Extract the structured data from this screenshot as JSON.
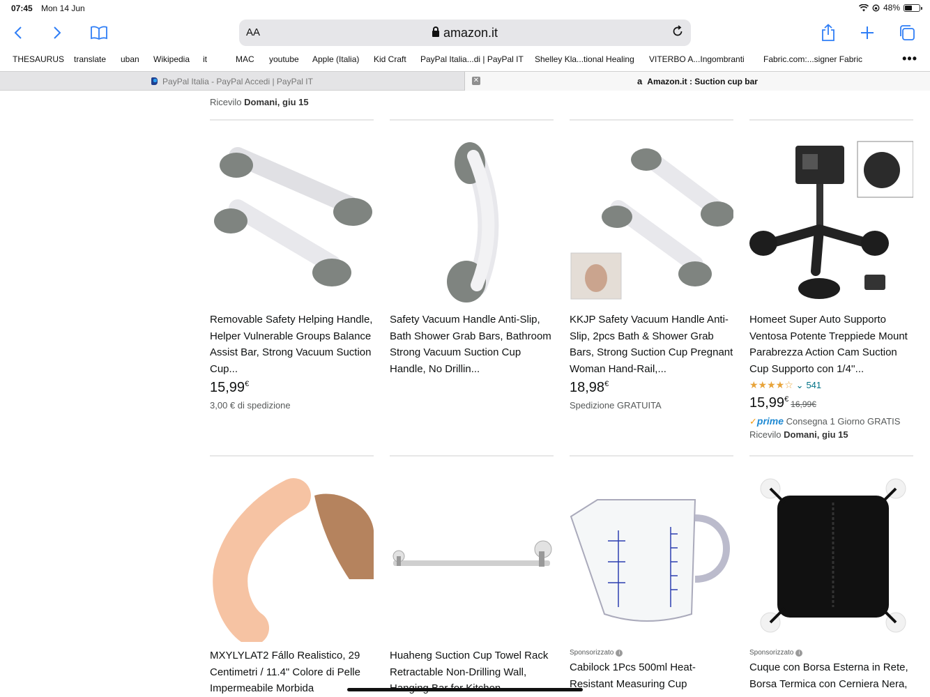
{
  "status_bar": {
    "time": "07:45",
    "date": "Mon 14 Jun",
    "battery": "48%",
    "battery_level": 0.48
  },
  "toolbar": {
    "aa_label": "AA",
    "domain": "amazon.it",
    "icons": [
      "back-icon",
      "forward-icon",
      "bookmarks-icon",
      "reload-icon",
      "share-icon",
      "new-tab-icon",
      "tabs-overview-icon"
    ]
  },
  "bookmarks": [
    "THESAURUS",
    "translate",
    "uban",
    "Wikipedia",
    "it",
    "MAC",
    "youtube",
    "Apple (Italia)",
    "Kid Craft",
    "PayPal Italia...di | PayPal IT",
    "Shelley Kla...tional Healing",
    "VITERBO A...Ingombranti",
    "Fabric.com:...signer Fabric"
  ],
  "bookmarks_more": "•••",
  "tabs": [
    {
      "title": "PayPal Italia - PayPal Accedi | PayPal IT",
      "active": false
    },
    {
      "title": "Amazon.it : Suction cup bar",
      "active": true
    }
  ],
  "previous_row": {
    "label": "Ricevilo ",
    "bold": "Domani, giu 15"
  },
  "products_row1": [
    {
      "title": "Removable Safety Helping Handle, Helper Vulnerable Groups Balance Assist Bar, Strong Vacuum Suction Cup...",
      "price": "15,99",
      "currency": "€",
      "shipping": "3,00 € di spedizione"
    },
    {
      "title": "Safety Vacuum Handle Anti-Slip, Bath Shower Grab Bars, Bathroom Strong Vacuum Suction Cup Handle, No Drillin...",
      "price": "",
      "currency": "",
      "shipping": ""
    },
    {
      "title": "KKJP Safety Vacuum Handle Anti-Slip, 2pcs Bath & Shower Grab Bars, Strong Suction Cup Pregnant Woman Hand-Rail,...",
      "price": "18,98",
      "currency": "€",
      "shipping": "Spedizione GRATUITA"
    },
    {
      "title": "Homeet Super Auto Supporto Ventosa Potente Treppiede Mount Parabrezza Action Cam Suction Cup Supporto con 1/4''...",
      "rating": 4.5,
      "stars": "★★★★☆",
      "rating_chevron": "⌄",
      "reviews": "541",
      "price": "15,99",
      "currency": "€",
      "old_price": "16,99€",
      "prime_check": "✓",
      "prime_label": "prime",
      "prime_text": " Consegna 1 Giorno GRATIS",
      "deliver_label": "Ricevilo ",
      "deliver_bold": "Domani, giu 15"
    }
  ],
  "products_row2": [
    {
      "title": "MXYLYLAT2 Fállo Realistico, 29 Centimetri / 11.4\" Colore di Pelle Impermeabile Morbida",
      "sponsored": ""
    },
    {
      "title": "Huaheng Suction Cup Towel Rack Retractable Non-Drilling Wall, Hanging Bar for Kitchen",
      "sponsored": ""
    },
    {
      "title": "Cabilock 1Pcs 500ml Heat-Resistant Measuring Cup",
      "sponsored": "Sponsorizzato",
      "info": "i"
    },
    {
      "title": "Cuque con Borsa Esterna in Rete, Borsa Termica con Cerniera Nera,",
      "sponsored": "Sponsorizzato",
      "info": "i"
    }
  ],
  "colors": {
    "accent": "#2f7ef6",
    "link": "#007185",
    "star": "#e8a43a",
    "prime": "#1f8ad3"
  }
}
